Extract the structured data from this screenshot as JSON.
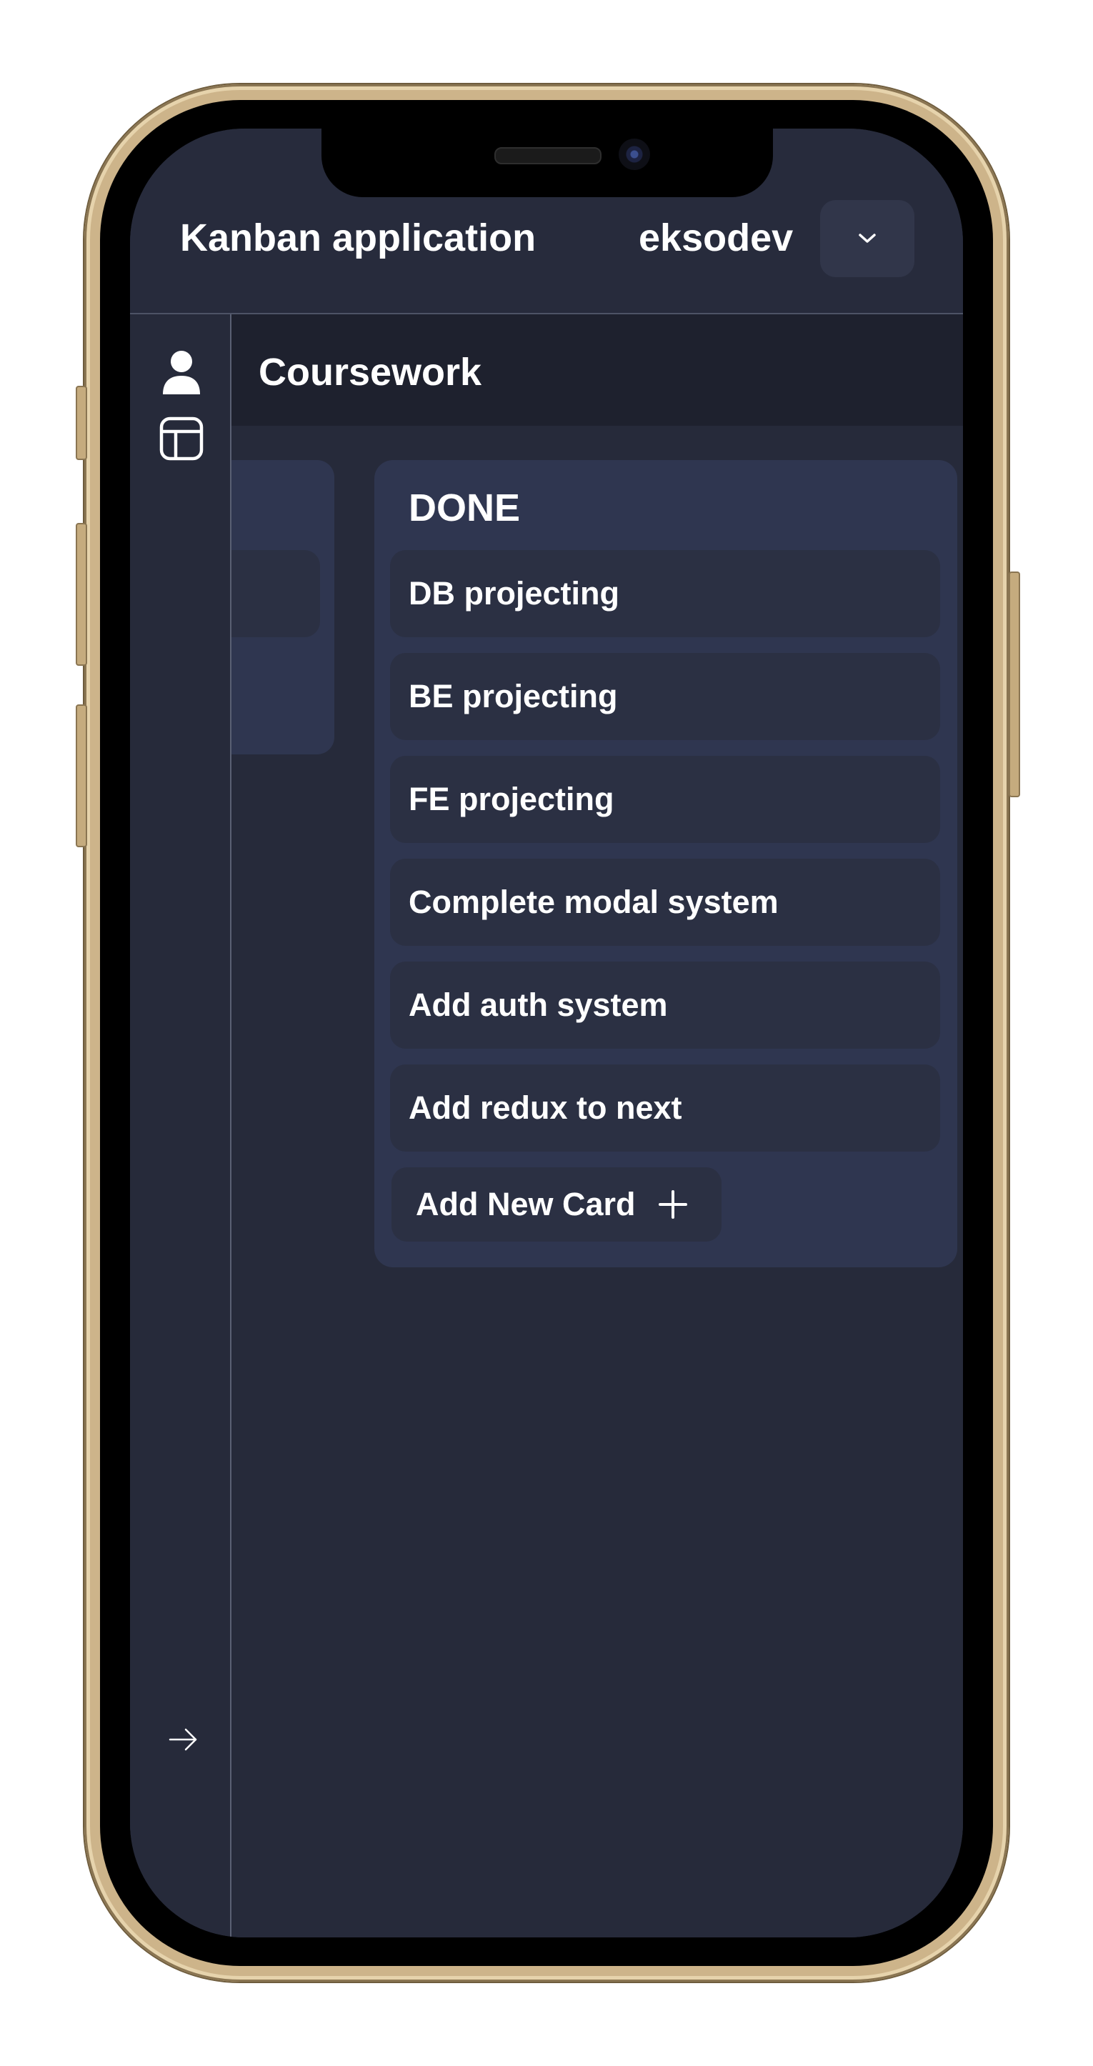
{
  "header": {
    "app_title": "Kanban application",
    "username": "eksodev",
    "menu_icon": "chevron-down-icon"
  },
  "sidebar": {
    "items": [
      {
        "icon": "user-icon"
      },
      {
        "icon": "layout-icon"
      }
    ],
    "footer_icon": "arrow-right-icon"
  },
  "board": {
    "title": "Coursework",
    "columns": [
      {
        "title": "DONE",
        "cards": [
          "DB projecting",
          "BE projecting",
          "FE projecting",
          "Complete modal system",
          "Add auth system",
          "Add redux to next"
        ],
        "add_button_label": "Add New Card"
      }
    ]
  },
  "colors": {
    "background": "#262a3a",
    "header": "#272b3c",
    "board_header": "#1e212e",
    "column": "#2f3650",
    "card": "#2b3043",
    "text": "#ffffff"
  }
}
